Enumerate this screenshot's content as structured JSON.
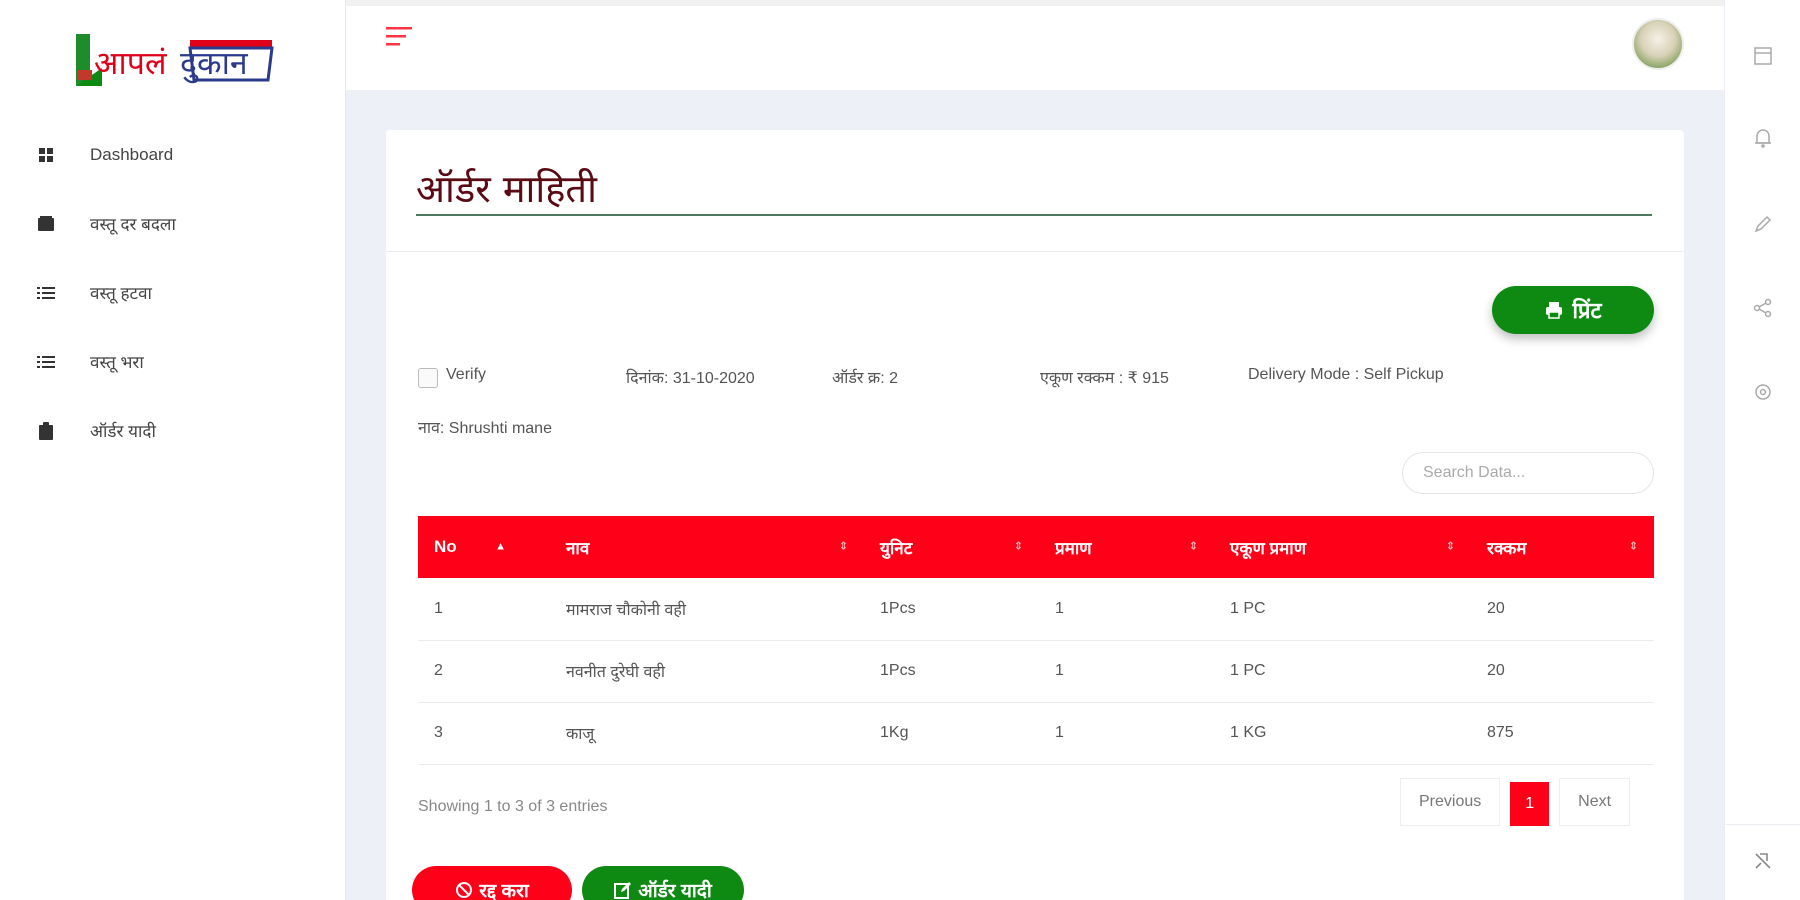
{
  "brand": {
    "logo_text": "आपलं दुकान"
  },
  "sidebar": {
    "items": [
      {
        "label": "Dashboard",
        "icon": "dashboard-icon"
      },
      {
        "label": "वस्तू दर बदला",
        "icon": "price-tag-icon"
      },
      {
        "label": "वस्तू हटवा",
        "icon": "list-icon"
      },
      {
        "label": "वस्तू भरा",
        "icon": "list-icon"
      },
      {
        "label": "ऑर्डर यादी",
        "icon": "clipboard-icon"
      }
    ]
  },
  "topbar": {
    "menu_icon": "hamburger-menu-icon",
    "avatar_icon": "user-avatar"
  },
  "right_strip": {
    "icons": [
      "panel-icon",
      "bell-icon",
      "pencil-icon",
      "share-icon",
      "settings-icon",
      "pin-icon"
    ]
  },
  "order": {
    "title": "ऑर्डर माहिती",
    "print_label": "प्रिंट",
    "verify_label": "Verify",
    "date_text": "दिनांक: 31-10-2020",
    "order_no_text": "ऑर्डर क्र: 2",
    "total_text": "एकूण रक्कम : ₹ 915",
    "delivery_text": "Delivery Mode : Self Pickup",
    "name_text": "नाव: Shrushti mane"
  },
  "search": {
    "placeholder": "Search Data..."
  },
  "table": {
    "headers": [
      "No",
      "नाव",
      "युनिट",
      "प्रमाण",
      "एकूण प्रमाण",
      "रक्कम"
    ],
    "rows": [
      [
        "1",
        "मामराज चौकोनी वही",
        "1Pcs",
        "1",
        "1 PC",
        "20"
      ],
      [
        "2",
        "नवनीत दुरेघी वही",
        "1Pcs",
        "1",
        "1 PC",
        "20"
      ],
      [
        "3",
        "काजू",
        "1Kg",
        "1",
        "1 KG",
        "875"
      ]
    ]
  },
  "footer": {
    "showing_text": "Showing 1 to 3 of 3 entries",
    "prev_label": "Previous",
    "page_label": "1",
    "next_label": "Next"
  },
  "actions": {
    "delete_label": "रद्द करा",
    "order_list_label": "ऑर्डर यादी"
  },
  "colors": {
    "accent_red": "#ff0019",
    "accent_green": "#0e8a13",
    "title_color": "#5a0a12"
  }
}
